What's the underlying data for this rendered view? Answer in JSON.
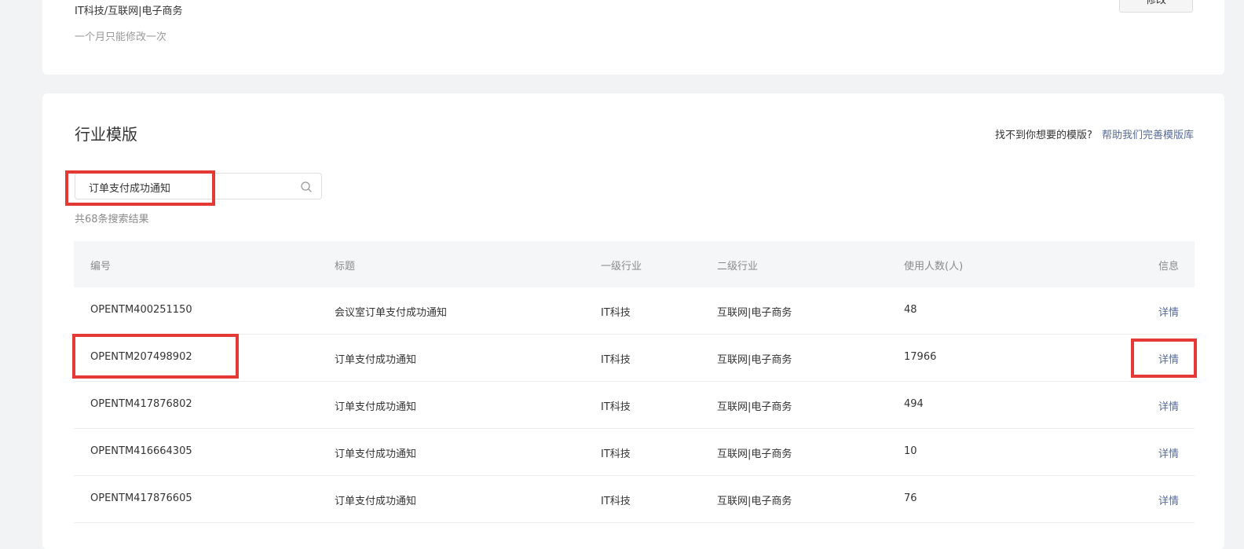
{
  "top_card": {
    "industry_value": "IT科技/互联网|电子商务",
    "industry_note": "一个月只能修改一次",
    "modify_button": "修改"
  },
  "section": {
    "title": "行业模版",
    "help_question": "找不到你想要的模版?",
    "help_link": "帮助我们完善模版库"
  },
  "search": {
    "value": "订单支付成功通知",
    "result_count": "共68条搜索结果"
  },
  "table": {
    "headers": {
      "id": "编号",
      "title": "标题",
      "l1": "一级行业",
      "l2": "二级行业",
      "users": "使用人数(人)",
      "info": "信息"
    },
    "rows": [
      {
        "id": "OPENTM400251150",
        "title": "会议室订单支付成功通知",
        "l1": "IT科技",
        "l2": "互联网|电子商务",
        "users": "48",
        "info": "详情"
      },
      {
        "id": "OPENTM207498902",
        "title": "订单支付成功通知",
        "l1": "IT科技",
        "l2": "互联网|电子商务",
        "users": "17966",
        "info": "详情"
      },
      {
        "id": "OPENTM417876802",
        "title": "订单支付成功通知",
        "l1": "IT科技",
        "l2": "互联网|电子商务",
        "users": "494",
        "info": "详情"
      },
      {
        "id": "OPENTM416664305",
        "title": "订单支付成功通知",
        "l1": "IT科技",
        "l2": "互联网|电子商务",
        "users": "10",
        "info": "详情"
      },
      {
        "id": "OPENTM417876605",
        "title": "订单支付成功通知",
        "l1": "IT科技",
        "l2": "互联网|电子商务",
        "users": "76",
        "info": "详情"
      }
    ]
  },
  "colors": {
    "highlight": "#e53935",
    "link": "#576b95",
    "header_bg": "#f5f6f8"
  }
}
